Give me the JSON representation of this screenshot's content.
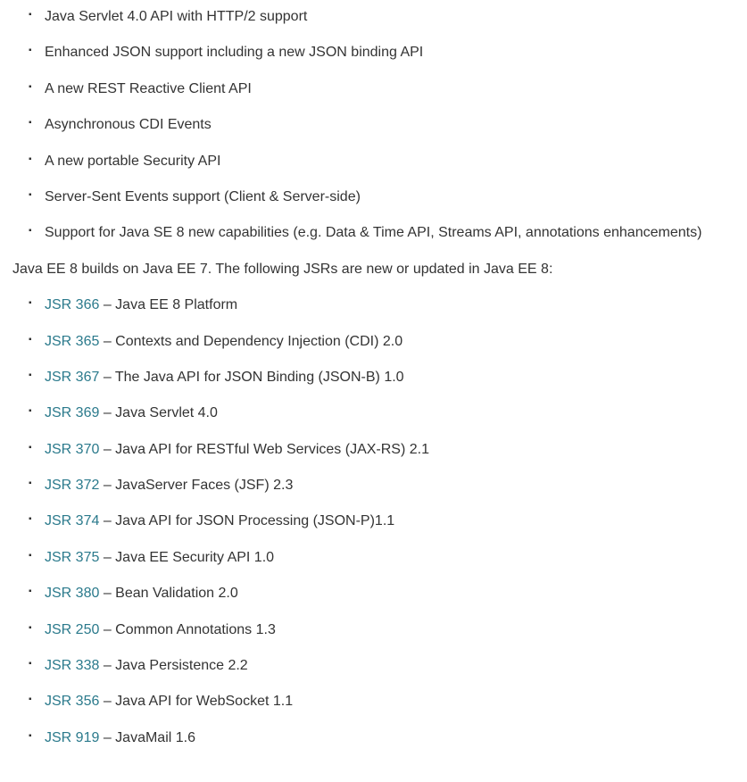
{
  "features": [
    "Java Servlet 4.0 API with HTTP/2 support",
    "Enhanced JSON support including a new JSON binding API",
    "A new REST Reactive Client API",
    "Asynchronous CDI Events",
    "A new portable Security API",
    "Server-Sent Events support (Client & Server-side)",
    "Support for Java SE 8 new capabilities (e.g. Data & Time API, Streams API, annotations enhancements)"
  ],
  "intro": "Java EE 8 builds on Java EE 7. The following JSRs are new or updated in Java EE 8:",
  "jsrs": [
    {
      "link": "JSR 366",
      "desc": "Java EE 8 Platform"
    },
    {
      "link": "JSR 365",
      "desc": "Contexts and Dependency Injection (CDI) 2.0"
    },
    {
      "link": "JSR 367",
      "desc": "The Java API for JSON Binding (JSON-B) 1.0"
    },
    {
      "link": "JSR 369",
      "desc": "Java Servlet 4.0"
    },
    {
      "link": "JSR 370",
      "desc": "Java API for RESTful Web Services (JAX-RS) 2.1"
    },
    {
      "link": "JSR 372",
      "desc": "JavaServer Faces (JSF) 2.3"
    },
    {
      "link": "JSR 374",
      "desc": "Java API for JSON Processing (JSON-P)1.1"
    },
    {
      "link": "JSR 375",
      "desc": "Java EE Security API 1.0"
    },
    {
      "link": "JSR 380",
      "desc": "Bean Validation 2.0"
    },
    {
      "link": "JSR 250",
      "desc": "Common Annotations 1.3"
    },
    {
      "link": "JSR 338",
      "desc": "Java Persistence 2.2"
    },
    {
      "link": "JSR 356",
      "desc": "Java API for WebSocket 1.1"
    },
    {
      "link": "JSR 919",
      "desc": "JavaMail 1.6"
    }
  ],
  "separator": " – "
}
